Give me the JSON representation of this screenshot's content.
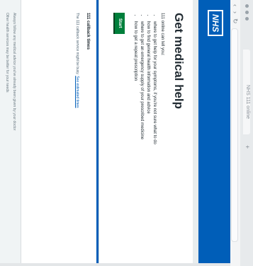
{
  "browser": {
    "tab_title": "NHS 111 online",
    "new_tab": "+"
  },
  "header": {
    "logo": "NHS"
  },
  "page": {
    "title": "Get medical help",
    "intro": "111 online can tell you:",
    "bullets": [
      "where to get help for your symptoms, if you're not sure what to do",
      "how to find general health information and advice",
      "where to get an emergency supply of your prescribed medicine",
      "how to get a repeat prescription"
    ],
    "start_button": "Start"
  },
  "callout": {
    "title": "111 callback times",
    "text": "The 111 callback service might be busy.",
    "link": "See estimated times"
  },
  "footer": {
    "line1": "Always follow any medical advice you've already been given by your doctor",
    "line2": "Other health services may be better for your needs"
  }
}
